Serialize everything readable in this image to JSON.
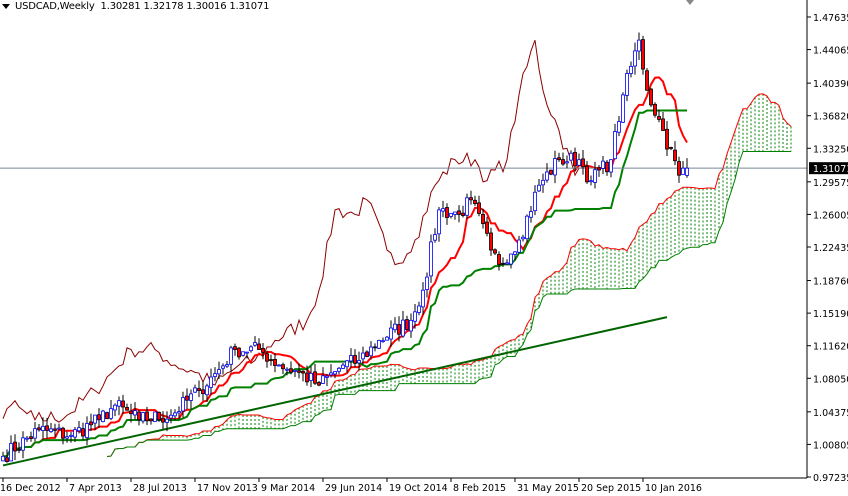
{
  "header": {
    "symbol": "USDCAD,Weekly",
    "ohlc": "1.30281 1.32178 1.30016 1.31071"
  },
  "chart_data": {
    "type": "candlestick",
    "title": "USDCAD,Weekly",
    "indicator": "Ichimoku Kinko Hyo (9, 26, 52)",
    "last_bar": {
      "open": 1.30281,
      "high": 1.32178,
      "low": 1.30016,
      "close": 1.31071
    },
    "current_price_label": "1.31071",
    "ylim": [
      0.97235,
      1.47635
    ],
    "y_ticks": [
      "1.47635",
      "1.44065",
      "1.40390",
      "1.36820",
      "1.33250",
      "1.29575",
      "1.26005",
      "1.22435",
      "1.18760",
      "1.15190",
      "1.11620",
      "1.08050",
      "1.04375",
      "1.00805",
      "0.97235"
    ],
    "x_ticks": [
      {
        "label": "16 Dec 2012",
        "week": 0
      },
      {
        "label": "7 Apr 2013",
        "week": 16
      },
      {
        "label": "28 Jul 2013",
        "week": 32
      },
      {
        "label": "17 Nov 2013",
        "week": 48
      },
      {
        "label": "9 Mar 2014",
        "week": 64
      },
      {
        "label": "29 Jun 2014",
        "week": 80
      },
      {
        "label": "19 Oct 2014",
        "week": 96
      },
      {
        "label": "8 Feb 2015",
        "week": 112
      },
      {
        "label": "31 May 2015",
        "week": 128
      },
      {
        "label": "20 Sep 2015",
        "week": 144
      },
      {
        "label": "10 Jan 2016",
        "week": 160
      }
    ],
    "close_anchors": [
      [
        0,
        0.995
      ],
      [
        9,
        1.024
      ],
      [
        17,
        1.018
      ],
      [
        24,
        1.035
      ],
      [
        28,
        1.051
      ],
      [
        34,
        1.035
      ],
      [
        42,
        1.04
      ],
      [
        49,
        1.067
      ],
      [
        54,
        1.09
      ],
      [
        58,
        1.112
      ],
      [
        64,
        1.112
      ],
      [
        69,
        1.095
      ],
      [
        74,
        1.087
      ],
      [
        79,
        1.073
      ],
      [
        85,
        1.095
      ],
      [
        89,
        1.1
      ],
      [
        94,
        1.122
      ],
      [
        102,
        1.144
      ],
      [
        105,
        1.177
      ],
      [
        109,
        1.265
      ],
      [
        114,
        1.26
      ],
      [
        117,
        1.276
      ],
      [
        122,
        1.221
      ],
      [
        124,
        1.205
      ],
      [
        129,
        1.232
      ],
      [
        134,
        1.292
      ],
      [
        139,
        1.32
      ],
      [
        144,
        1.32
      ],
      [
        147,
        1.297
      ],
      [
        152,
        1.32
      ],
      [
        155,
        1.391
      ],
      [
        159,
        1.451
      ],
      [
        161,
        1.396
      ],
      [
        165,
        1.352
      ],
      [
        169,
        1.303
      ],
      [
        171,
        1.31071
      ]
    ],
    "trendline": {
      "from": [
        0,
        0.985
      ],
      "to": [
        166,
        1.1475
      ]
    },
    "colors": {
      "bull_body": "#ffffff",
      "bull_border": "#0000ff",
      "bear_body": "#ff0000",
      "bear_border": "#000000",
      "tenkan": "#ff0000",
      "kijun": "#008000",
      "chikou": "#8b0000",
      "senkou_a": "#ff0000",
      "senkou_b": "#008000",
      "cloud_up": "#008000",
      "cloud_down": "#ff0000",
      "trendline": "#006400",
      "price_line": "#778899"
    }
  }
}
